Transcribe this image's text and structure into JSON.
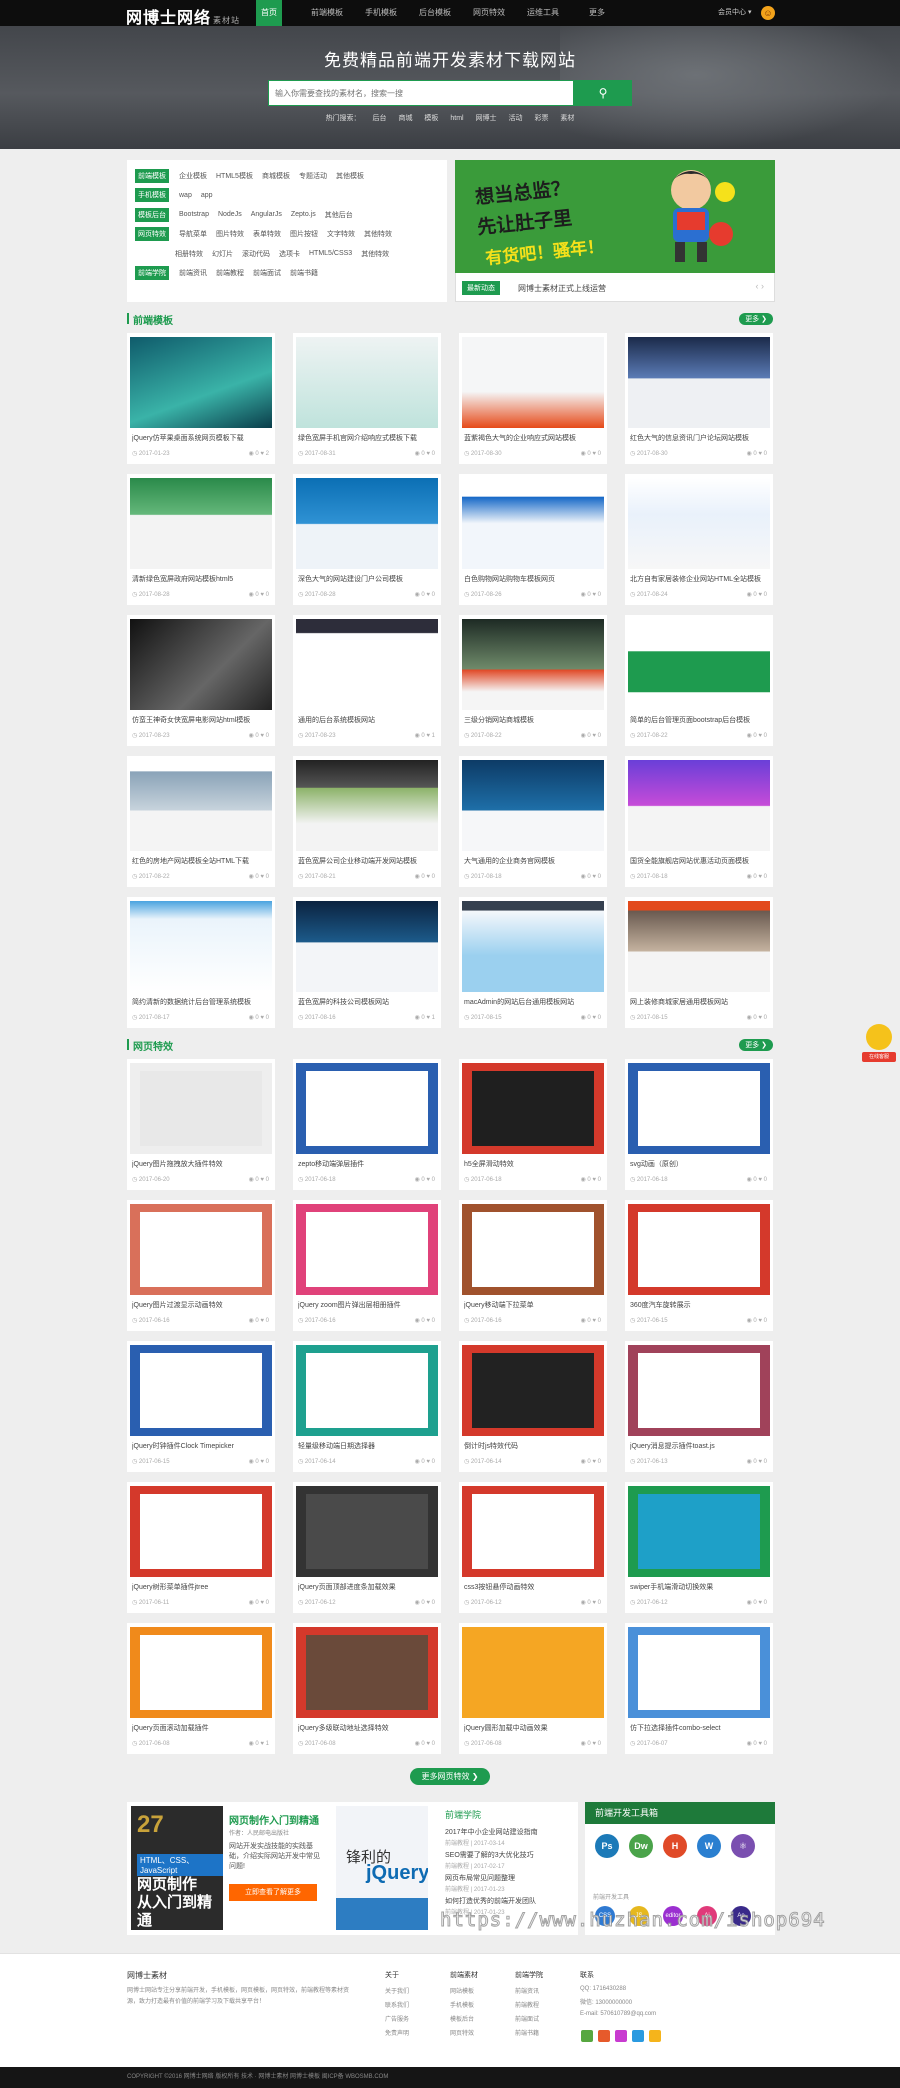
{
  "brand": {
    "logo": "网博士网络",
    "logo_sub": "素材站"
  },
  "nav": [
    "首页",
    "前端模板",
    "手机模板",
    "后台模板",
    "网页特效",
    "运维工具",
    "更多"
  ],
  "user": {
    "label": "会员中心 ▾"
  },
  "hero": {
    "title": "免费精品前端开发素材下载网站",
    "search_placeholder": "输入你需要查找的素材名，搜索一搜",
    "hot_label": "热门搜索：",
    "hot": [
      "后台",
      "商城",
      "模板",
      "html",
      "网博士",
      "活动",
      "彩票",
      "素材"
    ]
  },
  "cats": [
    {
      "tag": "前端模板",
      "items": [
        "企业模板",
        "HTML5模板",
        "商城模板",
        "专题活动",
        "其他模板"
      ]
    },
    {
      "tag": "手机模板",
      "items": [
        "wap",
        "app"
      ]
    },
    {
      "tag": "模板后台",
      "items": [
        "Bootstrap",
        "NodeJs",
        "AngularJs",
        "Zepto.js",
        "其他后台"
      ]
    },
    {
      "tag": "网页特效",
      "items": [
        "导航菜单",
        "图片特效",
        "表单特效",
        "图片按钮",
        "文字特效",
        "其他特效"
      ]
    },
    {
      "tag": "",
      "items": [
        "相册特效",
        "幻灯片",
        "滚动代码",
        "选项卡",
        "HTML5/CSS3",
        "其他特效"
      ]
    },
    {
      "tag": "前端学院",
      "items": [
        "前端资讯",
        "前端教程",
        "前端面试",
        "前端书籍"
      ]
    }
  ],
  "banner": {
    "line1": "想当总监？",
    "line2": "先让肚子里",
    "line3": "有货吧！骚年！",
    "tag": "最新动态",
    "text": "网博士素材正式上线运营"
  },
  "sec1": {
    "title": "前端模板",
    "more": "更多 ❯"
  },
  "sec2": {
    "title": "网页特效",
    "more": "更多 ❯"
  },
  "templates": [
    {
      "title": "jQuery仿苹果桌面系统网页模板下载",
      "date": "2017-01-23",
      "views": "0",
      "likes": "2"
    },
    {
      "title": "绿色宽屏手机官网介绍响应式模板下载",
      "date": "2017-08-31",
      "views": "0",
      "likes": "0"
    },
    {
      "title": "蓝紫褐色大气的企业响应式网站模板",
      "date": "2017-08-30",
      "views": "0",
      "likes": "0"
    },
    {
      "title": "红色大气的信息资讯门户论坛网站模板",
      "date": "2017-08-30",
      "views": "0",
      "likes": "0"
    },
    {
      "title": "清新绿色宽屏政府网站模板html5",
      "date": "2017-08-28",
      "views": "0",
      "likes": "0"
    },
    {
      "title": "深色大气的网站建设门户公司模板",
      "date": "2017-08-28",
      "views": "0",
      "likes": "0"
    },
    {
      "title": "白色购物网站购物车模板网页",
      "date": "2017-08-26",
      "views": "0",
      "likes": "0"
    },
    {
      "title": "北方自有家居装修企业网站HTML全站模板",
      "date": "2017-08-24",
      "views": "0",
      "likes": "0"
    },
    {
      "title": "仿蛮王神奇女侠宽屏电影网站html模板",
      "date": "2017-08-23",
      "views": "0",
      "likes": "0"
    },
    {
      "title": "通用的后台系统模板网站",
      "date": "2017-08-23",
      "views": "0",
      "likes": "1"
    },
    {
      "title": "三级分销网站商城模板",
      "date": "2017-08-22",
      "views": "0",
      "likes": "0"
    },
    {
      "title": "简单的后台管理页面bootstrap后台模板",
      "date": "2017-08-22",
      "views": "0",
      "likes": "0"
    },
    {
      "title": "红色的房地产网站模板全站HTML下载",
      "date": "2017-08-22",
      "views": "0",
      "likes": "0"
    },
    {
      "title": "蓝色宽屏公司企业移动端开发网站模板",
      "date": "2017-08-21",
      "views": "0",
      "likes": "0"
    },
    {
      "title": "大气通用的企业商务官网模板",
      "date": "2017-08-18",
      "views": "0",
      "likes": "0"
    },
    {
      "title": "国货全能旗舰店网站优惠活动页面模板",
      "date": "2017-08-18",
      "views": "0",
      "likes": "0"
    },
    {
      "title": "简约清新的数据统计后台管理系统模板",
      "date": "2017-08-17",
      "views": "0",
      "likes": "0"
    },
    {
      "title": "蓝色宽屏的科技公司模板网站",
      "date": "2017-08-16",
      "views": "0",
      "likes": "1"
    },
    {
      "title": "macAdmin的网站后台通用模板网站",
      "date": "2017-08-15",
      "views": "0",
      "likes": "0"
    },
    {
      "title": "网上装修商城家居通用模板网站",
      "date": "2017-08-15",
      "views": "0",
      "likes": "0"
    }
  ],
  "effects": [
    {
      "title": "jQuery图片拖拽放大插件特效",
      "date": "2017-06-20",
      "views": "0",
      "likes": "0"
    },
    {
      "title": "zepto移动端弹层插件",
      "date": "2017-06-18",
      "views": "0",
      "likes": "0"
    },
    {
      "title": "h5全屏滑动特效",
      "date": "2017-06-18",
      "views": "0",
      "likes": "0"
    },
    {
      "title": "svg动画（原创）",
      "date": "2017-06-18",
      "views": "0",
      "likes": "0"
    },
    {
      "title": "jQuery图片过渡显示动画特效",
      "date": "2017-06-16",
      "views": "0",
      "likes": "0"
    },
    {
      "title": "jQuery zoom图片弹出层相册插件",
      "date": "2017-06-16",
      "views": "0",
      "likes": "0"
    },
    {
      "title": "jQuery移动端下拉菜单",
      "date": "2017-06-16",
      "views": "0",
      "likes": "0"
    },
    {
      "title": "360度汽车旋转展示",
      "date": "2017-06-15",
      "views": "0",
      "likes": "0"
    },
    {
      "title": "jQuery时钟插件Clock Timepicker",
      "date": "2017-06-15",
      "views": "0",
      "likes": "0"
    },
    {
      "title": "轻量级移动端日期选择器",
      "date": "2017-06-14",
      "views": "0",
      "likes": "0"
    },
    {
      "title": "倒计时js特效代码",
      "date": "2017-06-14",
      "views": "0",
      "likes": "0"
    },
    {
      "title": "jQuery消息提示插件toast.js",
      "date": "2017-06-13",
      "views": "0",
      "likes": "0"
    },
    {
      "title": "jQuery树形菜单插件jtree",
      "date": "2017-06-11",
      "views": "0",
      "likes": "0"
    },
    {
      "title": "jQuery页面顶部进度条加载效果",
      "date": "2017-06-12",
      "views": "0",
      "likes": "0"
    },
    {
      "title": "css3按钮悬停动画特效",
      "date": "2017-06-12",
      "views": "0",
      "likes": "0"
    },
    {
      "title": "swiper手机端滑动切换效果",
      "date": "2017-06-12",
      "views": "0",
      "likes": "0"
    },
    {
      "title": "jQuery页面滚动加载插件",
      "date": "2017-06-08",
      "views": "0",
      "likes": "1"
    },
    {
      "title": "jQuery多级联动地址选择特效",
      "date": "2017-06-08",
      "views": "0",
      "likes": "0"
    },
    {
      "title": "jQuery圆形加载中动画效果",
      "date": "2017-06-08",
      "views": "0",
      "likes": "0"
    },
    {
      "title": "仿下拉选择插件combo-select",
      "date": "2017-06-07",
      "views": "0",
      "likes": "0"
    }
  ],
  "more_effects": "更多网页特效 ❯",
  "promo": {
    "book_title": "网页制作入门到精通",
    "book_sub": "作者：人民邮电出版社",
    "book_desc": "网站开发实战技能的实践基础，介绍实际网站开发中常见问题!",
    "book_btn": "立即查看了解更多",
    "book_c1": "HTML、CSS、JavaScript",
    "book_c2": "网页制作",
    "book_c3": "从入门到精通",
    "jq_a": "锋利的",
    "jq_b": "jQuery",
    "news_title": "前端学院",
    "news": [
      {
        "t": "2017年中小企业网站建设指南",
        "d": "前端教程 | 2017-03-14"
      },
      {
        "t": "SEO需要了解的3大优化技巧",
        "d": "前端教程 | 2017-02-17"
      },
      {
        "t": "网页布局常见问题整理",
        "d": "前端教程 | 2017-01-23"
      },
      {
        "t": "如何打造优秀的前端开发团队",
        "d": "前端教程 | 2017-01-23"
      }
    ],
    "tools_title": "前端开发工具箱",
    "tools_label": "前端开发工具",
    "tools_row1": [
      "Ps",
      "Dw",
      "H",
      "W",
      ""
    ],
    "tools_row2": [
      "CSS",
      "JS",
      "editor",
      "Ai",
      "Ae"
    ]
  },
  "watermark": "https://www.huzhan.com/ishop694",
  "footer": {
    "about_title": "网博士素材",
    "about_desc": "网博士网站专注分享前端开发，手机模板，网页模板，网页特效，前端教程等素材资源，致力打造最有价值的前端学习及下载共享平台！",
    "col1": {
      "t": "关于",
      "l": [
        "关于我们",
        "联系我们",
        "广告服务",
        "免责声明"
      ]
    },
    "col2": {
      "t": "前端素材",
      "l": [
        "网站模板",
        "手机模板",
        "模板后台",
        "网页特效"
      ]
    },
    "col3": {
      "t": "前端学院",
      "l": [
        "前端资讯",
        "前端教程",
        "前端面试",
        "前端书籍"
      ]
    },
    "contact": {
      "t": "联系",
      "l": [
        "QQ: 1716430288",
        "微信: 13000000000",
        "E-mail: 570610789@qq.com"
      ]
    },
    "copyright": "COPYRIGHT ©2016 网博士网络 版权所有 技术 · 网博士素材 网博士模板 闽ICP备 WBOSMB.COM"
  },
  "float": {
    "label": "在线客服"
  }
}
